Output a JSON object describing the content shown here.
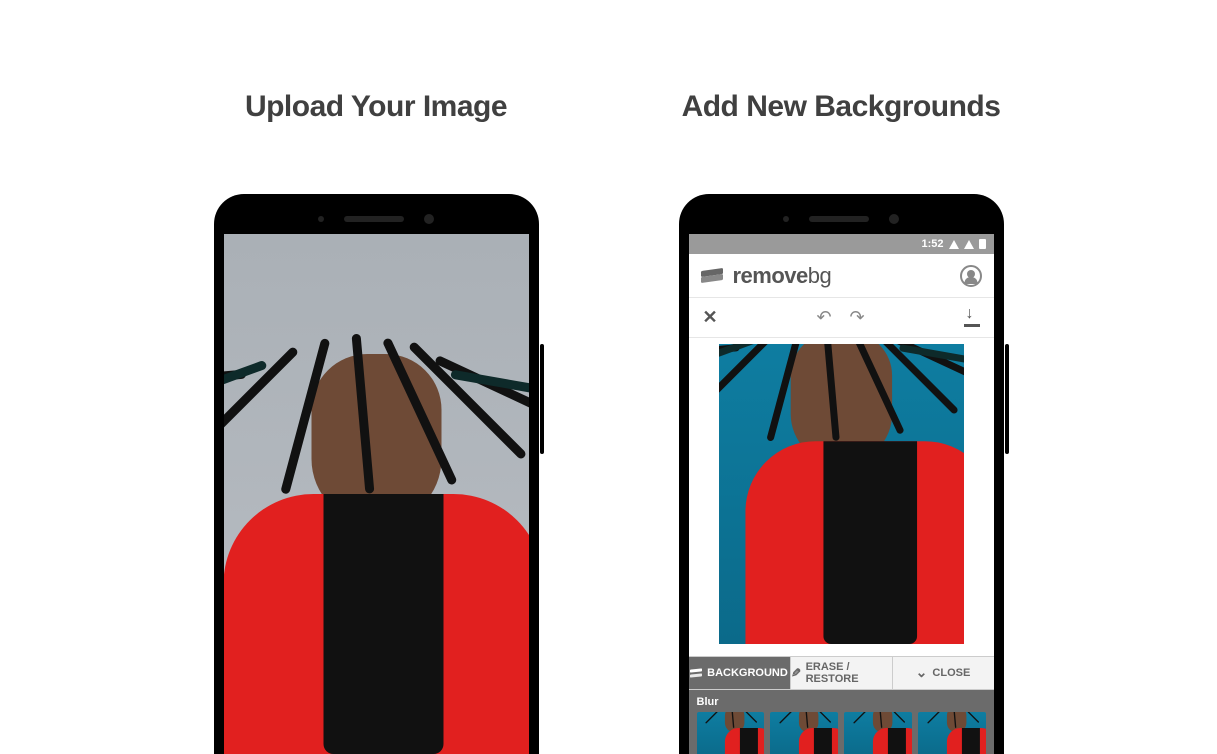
{
  "headings": {
    "left": "Upload Your Image",
    "right": "Add New Backgrounds"
  },
  "statusbar": {
    "time": "1:52"
  },
  "appbar": {
    "logo_primary": "remove",
    "logo_secondary": "bg"
  },
  "tabs": {
    "background": "BACKGROUND",
    "erase": "ERASE / RESTORE",
    "close": "CLOSE"
  },
  "thumbs": {
    "section_label": "Blur"
  }
}
